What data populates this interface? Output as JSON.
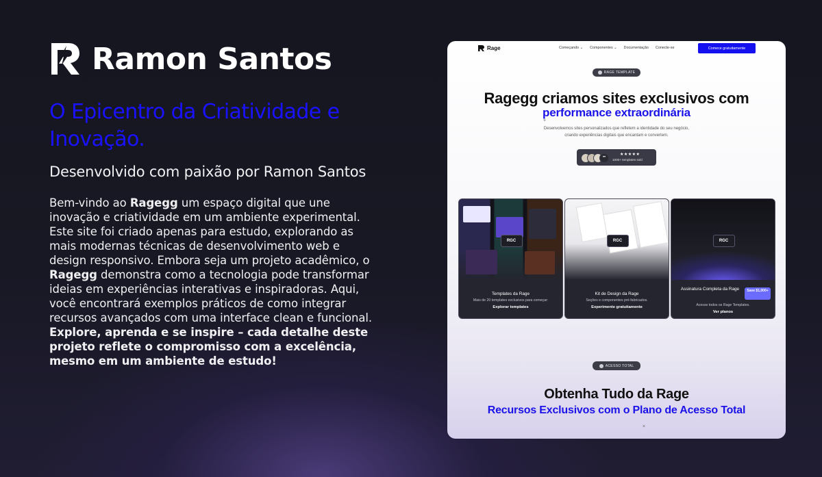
{
  "profile": {
    "name": "Ramon Santos",
    "headline": "O Epicentro da Criatividade e Inovação.",
    "subtitle": "Desenvolvido com paixão por Ramon Santos",
    "paragraph_parts": {
      "p1": "Bem-vindo ao ",
      "b1": "Ragegg",
      "p2": " um espaço digital que une inovação e criatividade em um ambiente experimental. Este site foi criado apenas para estudo, explorando as mais modernas técnicas de desenvolvimento web e design responsivo.  Embora seja um projeto acadêmico, o ",
      "b2": "Ragegg",
      "p3": " demonstra como a tecnologia pode transformar ideias em experiências interativas e inspiradoras. Aqui, você encontrará exemplos práticos de como integrar recursos avançados com uma interface clean e funcional.  ",
      "b3": "Explore, aprenda e se inspire – cada detalhe deste projeto reflete o compromisso com a excelência, mesmo em um ambiente de estudo!"
    }
  },
  "preview": {
    "nav": {
      "logo": "Rage",
      "links": [
        "Começando ⌄",
        "Componentes ⌄",
        "Documentação",
        "Conecte-se"
      ],
      "cta": "Comece gratuitamente"
    },
    "hero": {
      "badge": "RAGE TEMPLATE",
      "title": "Ragegg criamos sites exclusivos com",
      "title_highlight": "performance extraordinária",
      "description": "Desenvolvemos sites personalizados que refletem a identidade do seu negócio, criando experiências digitais que encantam e convertem.",
      "rating_stars": "★★★★★",
      "rating_text": "1000+ templates sold"
    },
    "cards": [
      {
        "title": "Templates da Rage",
        "subtitle": "Mais de 20 templates exclusivos para começar:",
        "link": "Explorar templates"
      },
      {
        "title": "Kit de Design da Rage",
        "subtitle": "Seções e componentes pré-fabricados.",
        "link": "Experimente gratuitamente"
      },
      {
        "title": "Assinatura Completa da Rage",
        "subtitle": "Acesse todos os Rage Templates.",
        "link": "Ver planos",
        "price_badge": "Save $1,000+"
      }
    ],
    "card_badge": "RGC",
    "access": {
      "badge": "ACESSO TOTAL",
      "title": "Obtenha Tudo da Rage",
      "subtitle": "Recursos Exclusivos com o Plano de Acesso Total"
    }
  },
  "colors": {
    "accent": "#1a12ff",
    "cta": "#1410f0",
    "background": "#15161f"
  }
}
